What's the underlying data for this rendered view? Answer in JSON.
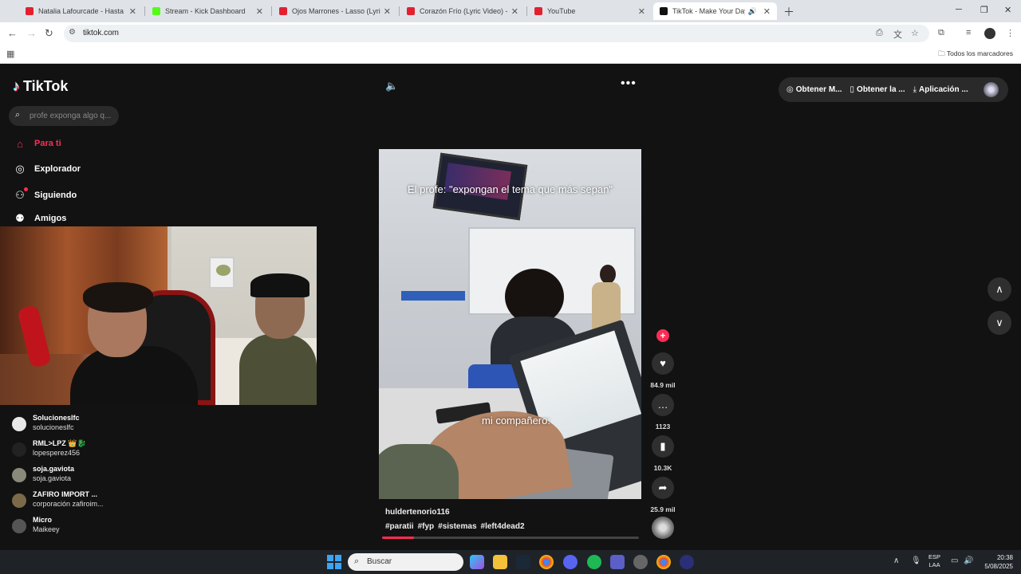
{
  "browser": {
    "tabs": [
      {
        "title": "Natalia Lafourcade - Hasta La R",
        "favicon_color": "#e4202f"
      },
      {
        "title": "Stream - Kick Dashboard",
        "favicon_color": "#53fc18"
      },
      {
        "title": "Ojos Marrones - Lasso (Lyrics V",
        "favicon_color": "#e4202f"
      },
      {
        "title": "Corazón Frío (Lyric Video) - Jas",
        "favicon_color": "#e4202f"
      },
      {
        "title": "YouTube",
        "favicon_color": "#e4202f"
      },
      {
        "title": "TikTok - Make Your Day",
        "favicon_color": "#111111",
        "active": true
      }
    ],
    "url": "tiktok.com",
    "bookmarks_label": "Todos los marcadores"
  },
  "tiktok": {
    "logo_text": "TikTok",
    "search_placeholder": "profe exponga algo q...",
    "nav": [
      {
        "label": "Para ti",
        "icon": "home-icon"
      },
      {
        "label": "Explorador",
        "icon": "compass-icon"
      },
      {
        "label": "Siguiendo",
        "icon": "following-icon"
      },
      {
        "label": "Amigos",
        "icon": "friends-icon"
      }
    ],
    "accounts": [
      {
        "name": "Solucioneslfc",
        "handle": "solucioneslfc"
      },
      {
        "name": "RML>LPZ 👑🐉",
        "handle": "lopesperez456"
      },
      {
        "name": "soja.gaviota",
        "handle": "soja.gaviota"
      },
      {
        "name": "ZAFIRO IMPORT ...",
        "handle": "corporación zafiroim..."
      },
      {
        "name": "Micro",
        "handle": "Maikeey"
      }
    ],
    "video": {
      "caption_top": "El profe: \"expongan el tema que más sepan\"",
      "caption_bottom": "mi compañero:",
      "author": "huldertenorio116",
      "tags": [
        "#paratii",
        "#fyp",
        "#sistemas",
        "#left4dead2"
      ],
      "progress_fraction": 0.125
    },
    "actions": {
      "likes": "84.9 mil",
      "comments": "1123",
      "saves": "10.3K",
      "shares": "25.9 mil"
    },
    "top_right": {
      "coins": "Obtener M...",
      "app": "Obtener la ...",
      "desktop": "Aplicación ..."
    },
    "accent_color": "#fe2c55"
  },
  "taskbar": {
    "search_placeholder": "Buscar",
    "lang_line1": "ESP",
    "lang_line2": "LAA",
    "time": "20:38",
    "date": "5/08/2025"
  }
}
